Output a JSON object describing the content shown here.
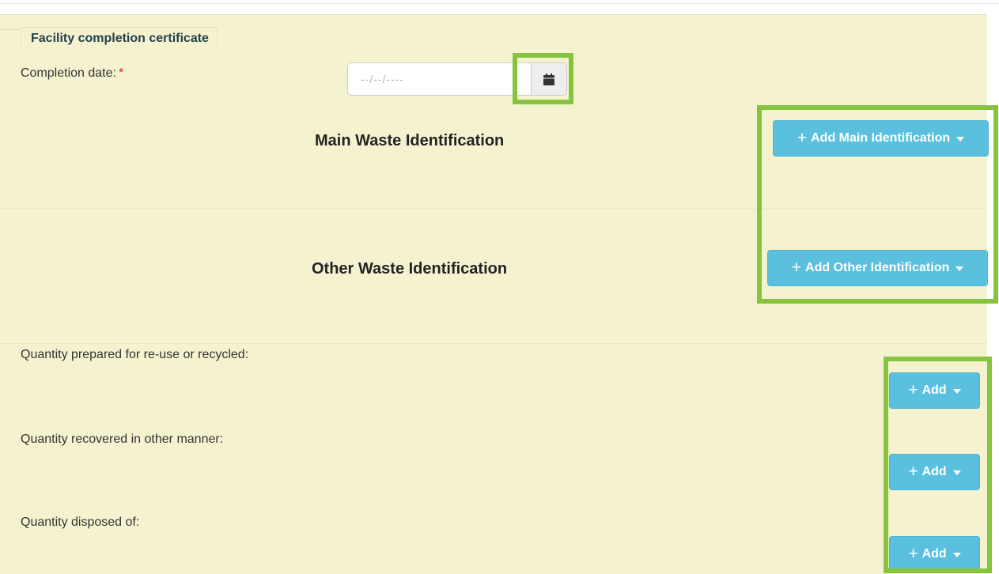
{
  "section": {
    "legend": "Facility completion certificate"
  },
  "completion_date": {
    "label": "Completion date:",
    "required_marker": "*",
    "placeholder": "--/--/----",
    "calendar_icon": "calendar-icon"
  },
  "main_waste": {
    "title": "Main Waste Identification",
    "add_label": "Add Main Identification"
  },
  "other_waste": {
    "title": "Other Waste Identification",
    "add_label": "Add Other Identification"
  },
  "quantities": [
    {
      "label": "Quantity prepared for re-use or recycled:",
      "add_label": "Add"
    },
    {
      "label": "Quantity recovered in other manner:",
      "add_label": "Add"
    },
    {
      "label": "Quantity disposed of:",
      "add_label": "Add"
    }
  ],
  "colors": {
    "panel_bg": "#f5f3cf",
    "button_info": "#5bc0de",
    "highlight": "#86c440",
    "legend_text": "#24404a"
  }
}
